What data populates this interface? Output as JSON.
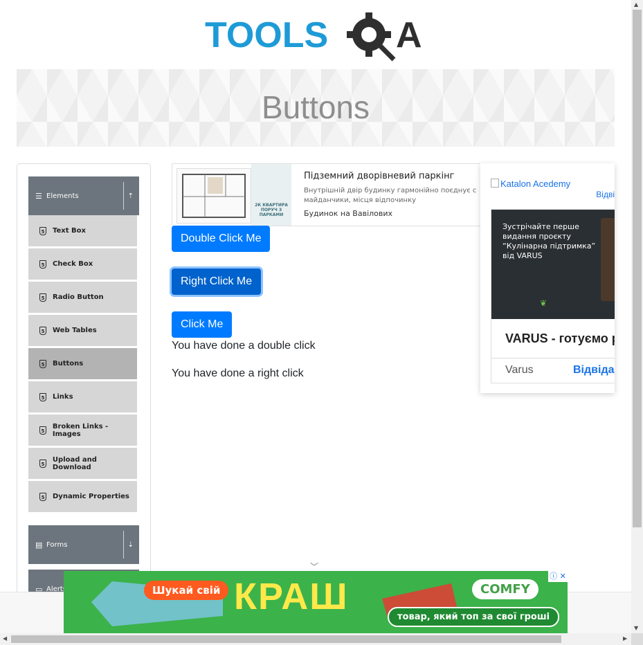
{
  "logo": {
    "text_left": "TOOLS",
    "text_right": "QA"
  },
  "banner": {
    "title": "Buttons"
  },
  "sidebar": {
    "elements_header": "Elements",
    "items": [
      {
        "label": "Text Box"
      },
      {
        "label": "Check Box"
      },
      {
        "label": "Radio Button"
      },
      {
        "label": "Web Tables"
      },
      {
        "label": "Buttons"
      },
      {
        "label": "Links"
      },
      {
        "label": "Broken Links - Images"
      },
      {
        "label": "Upload and Download"
      },
      {
        "label": "Dynamic Properties"
      }
    ],
    "forms_header": "Forms",
    "alerts_header": "Alerts,"
  },
  "top_ad": {
    "title": "Підземний дворівневий паркінг",
    "body": "Внутрішній двір будинку гармонійно поєднує с майданчики, місця відпочинку",
    "sponsor": "Будинок на Вавілових",
    "plan_caption": "2К КВАРТИРА ПОРУЧ З ПАРКАМИ"
  },
  "buttons": {
    "double_click": "Double Click Me",
    "right_click": "Right Click Me",
    "click": "Click Me"
  },
  "messages": {
    "double": "You have done a double click",
    "right": "You have done a right click"
  },
  "side_ad": {
    "image_alt": "Katalon Acedemy",
    "visit_short": "Відві",
    "promo_text": "Зустрічайте перше видання проєкту “Кулінарна підтримка” від VARUS",
    "headline": "VARUS - готуємо ра",
    "advertiser": "Varus",
    "cta": "Відвідайте"
  },
  "bottom_ad": {
    "pill1": "Шукай свій",
    "big": "КРАШ",
    "brand": "COMFY",
    "tagline": "товар, який топ за свої гроші",
    "close": "ⓘ ✕"
  },
  "colors": {
    "primary": "#007bff",
    "sidebar_header": "#6c757d",
    "logo_blue": "#1e9bd7"
  }
}
